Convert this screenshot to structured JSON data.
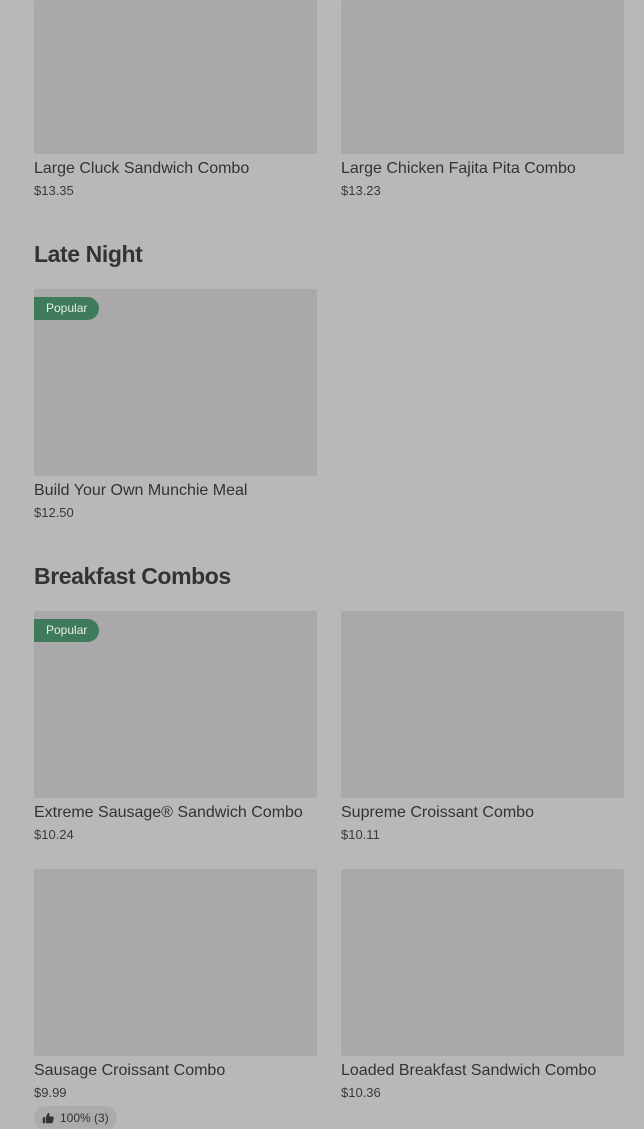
{
  "top_row": [
    {
      "name": "Large Cluck Sandwich Combo",
      "price": "$13.35"
    },
    {
      "name": "Large Chicken Fajita Pita Combo",
      "price": "$13.23"
    }
  ],
  "late_night": {
    "title": "Late Night",
    "items": [
      {
        "badge": "Popular",
        "name": "Build Your Own Munchie Meal",
        "price": "$12.50"
      }
    ]
  },
  "breakfast_combos": {
    "title": "Breakfast Combos",
    "items": [
      {
        "badge": "Popular",
        "name": "Extreme Sausage® Sandwich Combo",
        "price": "$10.24"
      },
      {
        "name": "Supreme Croissant Combo",
        "price": "$10.11"
      },
      {
        "name": "Sausage Croissant Combo",
        "price": "$9.99",
        "rating": "100% (3)"
      },
      {
        "name": "Loaded Breakfast Sandwich Combo",
        "price": "$10.36"
      }
    ]
  },
  "colors": {
    "background": "#b8b8b8",
    "image_placeholder": "#a9a9a9",
    "badge": "#3f7a5c"
  },
  "icons": {
    "rating": "thumbs-up-icon"
  }
}
